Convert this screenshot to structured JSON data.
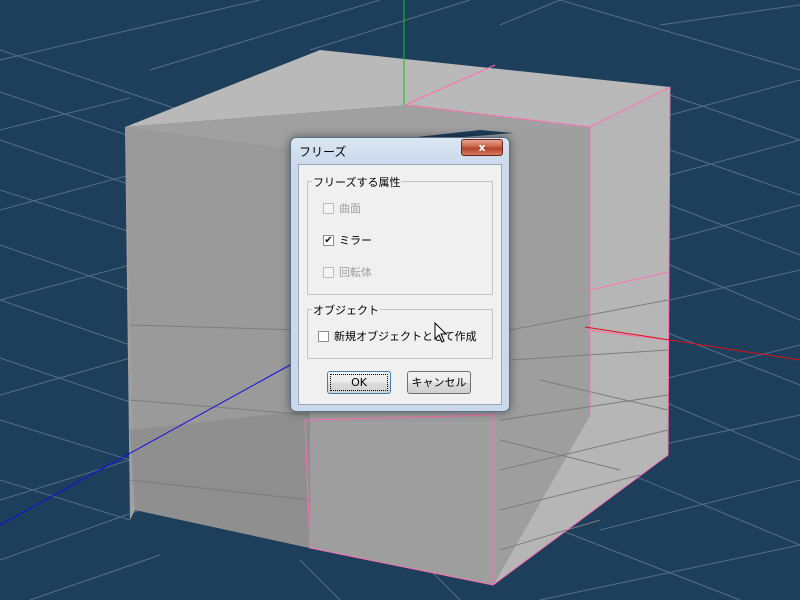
{
  "dialog": {
    "title": "フリーズ",
    "close_glyph": "x",
    "group_freeze": {
      "legend": "フリーズする属性",
      "options": [
        {
          "label": "曲面",
          "checked": false,
          "enabled": false
        },
        {
          "label": "ミラー",
          "checked": true,
          "enabled": true
        },
        {
          "label": "回転体",
          "checked": false,
          "enabled": false
        }
      ]
    },
    "group_object": {
      "legend": "オブジェクト",
      "option": {
        "label": "新規オブジェクトとして作成",
        "checked": false,
        "enabled": true
      }
    },
    "ok_label": "OK",
    "cancel_label": "キャンセル",
    "check_glyph": "✔"
  },
  "colors": {
    "background": "#1e3f5c",
    "grid": "#5f7b92",
    "cube_face": "#a5a5a5",
    "selection": "#ff6fb0",
    "axis_x": "#e01010",
    "axis_y": "#10c020",
    "axis_z": "#1010e0"
  }
}
